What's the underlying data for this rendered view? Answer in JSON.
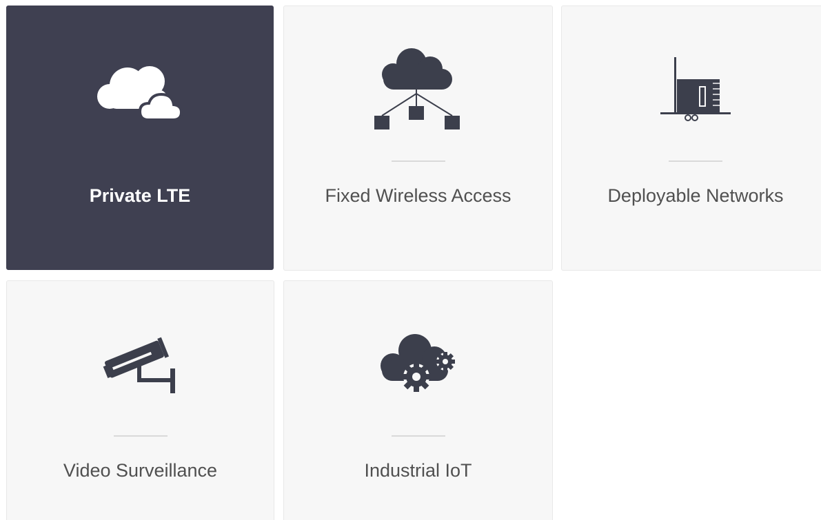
{
  "tiles": [
    {
      "label": "Private LTE",
      "icon": "cloud-icon",
      "active": true
    },
    {
      "label": "Fixed Wireless Access",
      "icon": "cloud-network-icon",
      "active": false
    },
    {
      "label": "Deployable Networks",
      "icon": "deployable-trailer-icon",
      "active": false
    },
    {
      "label": "Video Surveillance",
      "icon": "security-camera-icon",
      "active": false
    },
    {
      "label": "Industrial IoT",
      "icon": "cloud-gears-icon",
      "active": false
    }
  ],
  "colors": {
    "active_tile": "#3f4051",
    "tile_background": "#f7f7f7",
    "icon": "#3c3f4c",
    "label_text": "#505050"
  }
}
